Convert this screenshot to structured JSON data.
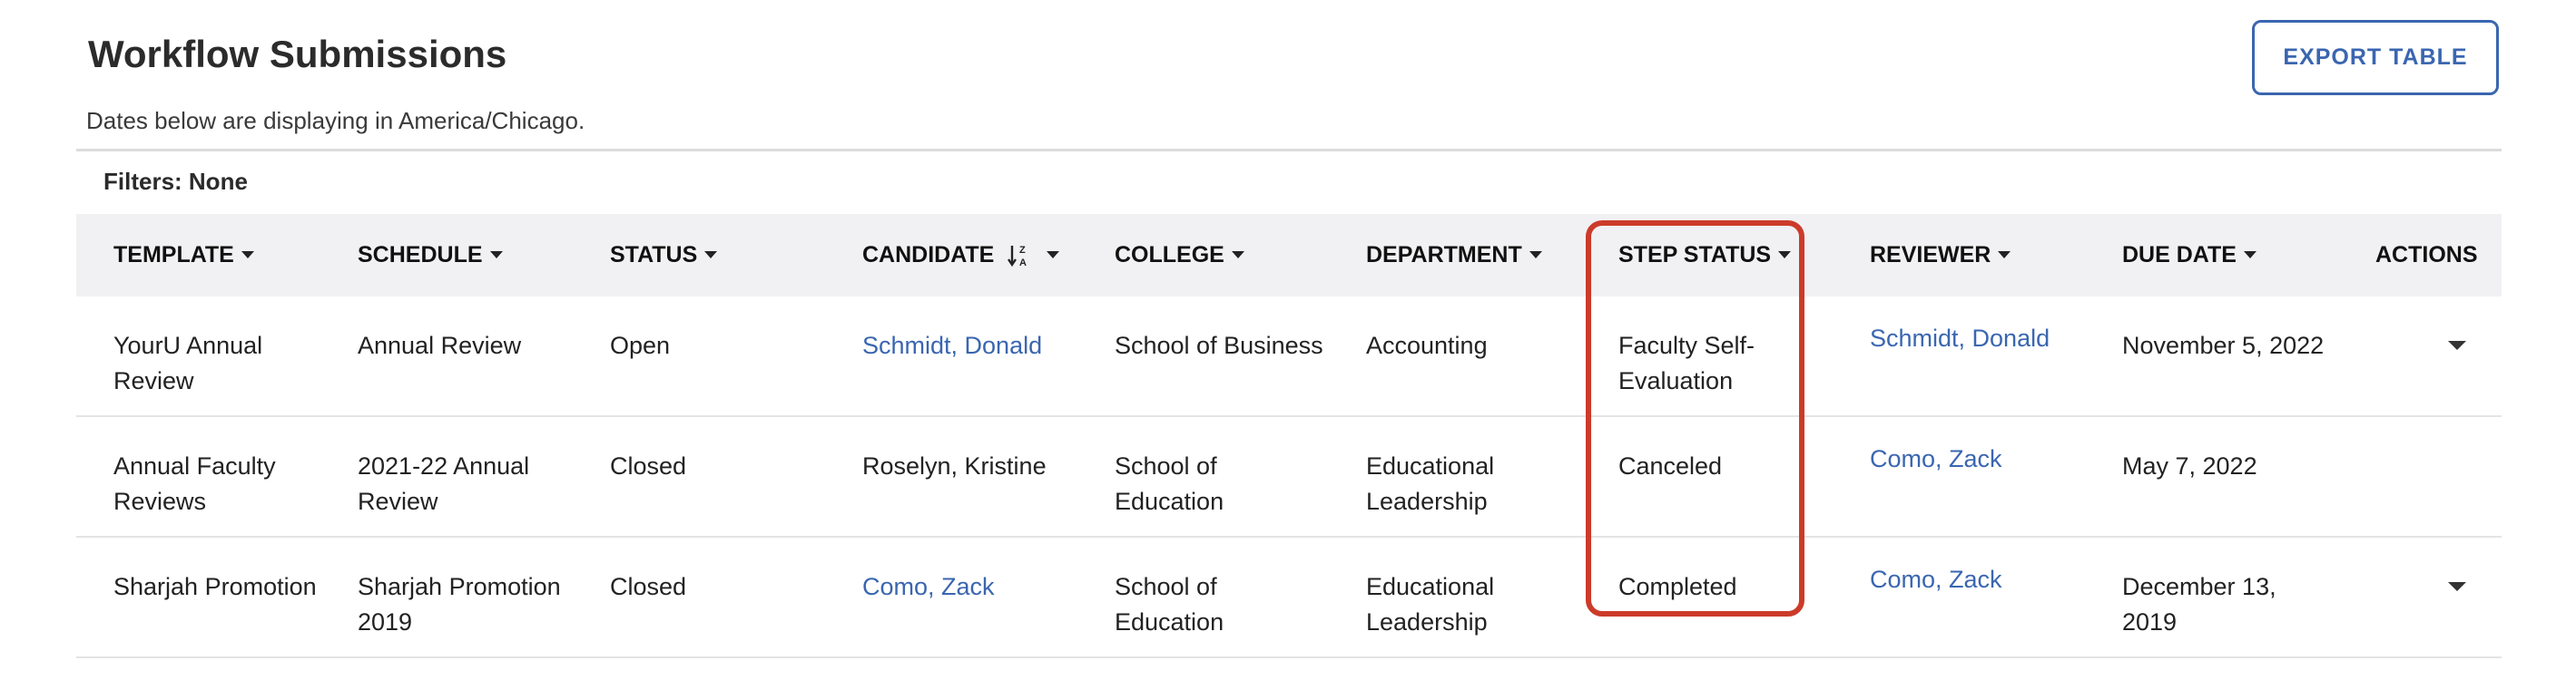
{
  "header": {
    "title": "Workflow Submissions",
    "export_label": "EXPORT TABLE",
    "tz_note": "Dates below are displaying in America/Chicago.",
    "filters": "Filters: None"
  },
  "columns": [
    {
      "label": "TEMPLATE",
      "control": "dropdown-caret"
    },
    {
      "label": "SCHEDULE",
      "control": "dropdown-caret"
    },
    {
      "label": "STATUS",
      "control": "dropdown-caret"
    },
    {
      "label": "CANDIDATE",
      "control": "sort-descending-icon"
    },
    {
      "label": "COLLEGE",
      "control": "dropdown-caret"
    },
    {
      "label": "DEPARTMENT",
      "control": "dropdown-caret"
    },
    {
      "label": "STEP STATUS",
      "control": "dropdown-caret"
    },
    {
      "label": "REVIEWER",
      "control": "dropdown-caret"
    },
    {
      "label": "DUE DATE",
      "control": "dropdown-caret"
    },
    {
      "label": "ACTIONS",
      "control": "none"
    }
  ],
  "rows": [
    {
      "template": "YourU Annual Review",
      "schedule": "Annual Review",
      "status": "Open",
      "candidate": "Schmidt, Donald",
      "candidate_is_link": true,
      "college": "School of Business",
      "department": "Accounting",
      "step_status": "Faculty Self-Evaluation",
      "reviewer": "Schmidt, Donald",
      "due_date": "November 5, 2022",
      "has_actions": true
    },
    {
      "template": "Annual Faculty Reviews",
      "schedule": "2021-22 Annual Review",
      "status": "Closed",
      "candidate": "Roselyn, Kristine",
      "candidate_is_link": false,
      "college": "School of Education",
      "department": "Educational Leadership",
      "step_status": "Canceled",
      "reviewer": "Como, Zack",
      "due_date": "May 7, 2022",
      "has_actions": false
    },
    {
      "template": "Sharjah Promotion",
      "schedule": "Sharjah Promotion 2019",
      "status": "Closed",
      "candidate": "Como, Zack",
      "candidate_is_link": true,
      "college": "School of Education",
      "department": "Educational Leadership",
      "step_status": "Completed",
      "reviewer": "Como, Zack",
      "due_date": "December 13, 2019",
      "has_actions": true
    }
  ],
  "colors": {
    "link": "#3a66b0",
    "highlight": "#cc3b2a",
    "header_bg": "#f1f1f3"
  }
}
